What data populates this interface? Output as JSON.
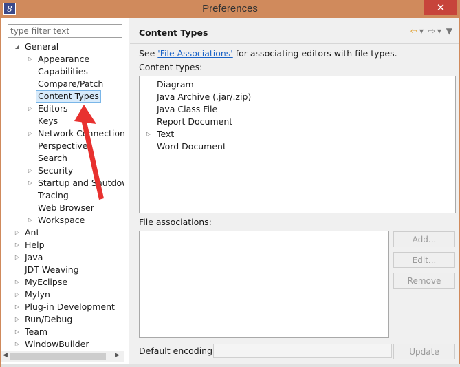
{
  "window": {
    "title": "Preferences",
    "icon_glyph": "8",
    "close_glyph": "✕"
  },
  "left": {
    "filter_placeholder": "type filter text",
    "tree": [
      {
        "label": "General",
        "level": 0,
        "twisty": "open"
      },
      {
        "label": "Appearance",
        "level": 1,
        "twisty": "closed"
      },
      {
        "label": "Capabilities",
        "level": 1,
        "twisty": "none"
      },
      {
        "label": "Compare/Patch",
        "level": 1,
        "twisty": "none"
      },
      {
        "label": "Content Types",
        "level": 1,
        "twisty": "none",
        "selected": true
      },
      {
        "label": "Editors",
        "level": 1,
        "twisty": "closed"
      },
      {
        "label": "Keys",
        "level": 1,
        "twisty": "none"
      },
      {
        "label": "Network Connections",
        "level": 1,
        "twisty": "closed"
      },
      {
        "label": "Perspectives",
        "level": 1,
        "twisty": "none"
      },
      {
        "label": "Search",
        "level": 1,
        "twisty": "none"
      },
      {
        "label": "Security",
        "level": 1,
        "twisty": "closed"
      },
      {
        "label": "Startup and Shutdown",
        "level": 1,
        "twisty": "closed"
      },
      {
        "label": "Tracing",
        "level": 1,
        "twisty": "none"
      },
      {
        "label": "Web Browser",
        "level": 1,
        "twisty": "none"
      },
      {
        "label": "Workspace",
        "level": 1,
        "twisty": "closed"
      },
      {
        "label": "Ant",
        "level": 0,
        "twisty": "closed"
      },
      {
        "label": "Help",
        "level": 0,
        "twisty": "closed"
      },
      {
        "label": "Java",
        "level": 0,
        "twisty": "closed"
      },
      {
        "label": "JDT Weaving",
        "level": 0,
        "twisty": "none"
      },
      {
        "label": "MyEclipse",
        "level": 0,
        "twisty": "closed"
      },
      {
        "label": "Mylyn",
        "level": 0,
        "twisty": "closed"
      },
      {
        "label": "Plug-in Development",
        "level": 0,
        "twisty": "closed"
      },
      {
        "label": "Run/Debug",
        "level": 0,
        "twisty": "closed"
      },
      {
        "label": "Team",
        "level": 0,
        "twisty": "closed"
      },
      {
        "label": "WindowBuilder",
        "level": 0,
        "twisty": "closed"
      }
    ]
  },
  "right": {
    "title": "Content Types",
    "see_prefix": "See ",
    "see_link": "'File Associations'",
    "see_suffix": " for associating editors with file types.",
    "content_types_label": "Content types:",
    "content_types": [
      {
        "label": "Diagram",
        "twisty": false
      },
      {
        "label": "Java Archive (.jar/.zip)",
        "twisty": false
      },
      {
        "label": "Java Class File",
        "twisty": false
      },
      {
        "label": "Report Document",
        "twisty": false
      },
      {
        "label": "Text",
        "twisty": true
      },
      {
        "label": "Word Document",
        "twisty": false
      }
    ],
    "file_assoc_label": "File associations:",
    "add_label": "Add...",
    "edit_label": "Edit...",
    "remove_label": "Remove",
    "encoding_label": "Default encoding:",
    "update_label": "Update"
  }
}
